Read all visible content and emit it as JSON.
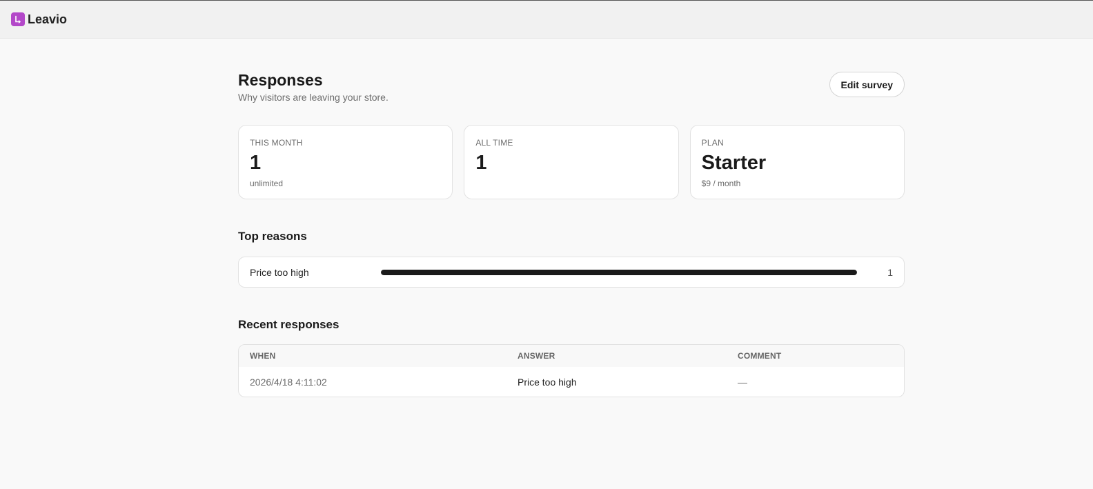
{
  "app": {
    "name": "Leavio"
  },
  "header": {
    "title": "Responses",
    "subtitle": "Why visitors are leaving your store.",
    "edit_label": "Edit survey"
  },
  "stats": [
    {
      "label": "THIS MONTH",
      "value": "1",
      "note": "unlimited"
    },
    {
      "label": "ALL TIME",
      "value": "1",
      "note": ""
    },
    {
      "label": "PLAN",
      "value": "Starter",
      "note": "$9 / month"
    }
  ],
  "top_reasons": {
    "title": "Top reasons",
    "items": [
      {
        "label": "Price too high",
        "count": "1",
        "fraction": 1.0
      }
    ]
  },
  "recent": {
    "title": "Recent responses",
    "columns": [
      "WHEN",
      "ANSWER",
      "COMMENT"
    ],
    "rows": [
      {
        "when": "2026/4/18 4:11:02",
        "answer": "Price too high",
        "comment": "—"
      }
    ]
  },
  "colors": {
    "brand": "#b348c9",
    "bar": "#1a1a1a"
  },
  "icons": {
    "logo": "leavio-logo-icon"
  }
}
